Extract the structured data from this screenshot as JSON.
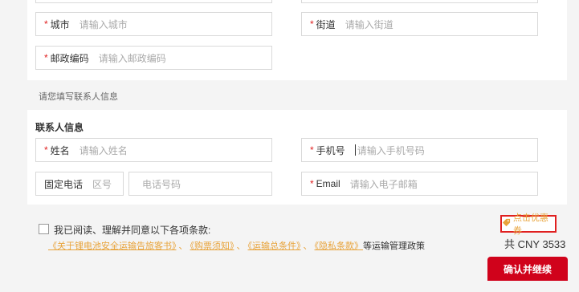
{
  "address": {
    "city": {
      "label": "城市",
      "placeholder": "请输入城市"
    },
    "street": {
      "label": "街道",
      "placeholder": "请输入街道"
    },
    "postcode": {
      "label": "邮政编码",
      "placeholder": "请输入邮政编码"
    }
  },
  "contact_hint": "请您填写联系人信息",
  "contact": {
    "title": "联系人信息",
    "name": {
      "label": "姓名",
      "placeholder": "请输入姓名"
    },
    "mobile": {
      "label": "手机号",
      "placeholder": "请输入手机号码"
    },
    "landline": {
      "label": "固定电话",
      "area_placeholder": "区号",
      "phone_placeholder": "电话号码"
    },
    "email": {
      "label": "Email",
      "placeholder": "请输入电子邮箱"
    }
  },
  "agreement": {
    "text": "我已阅读、理解并同意以下各项条款:",
    "links": [
      "《关于锂电池安全运输告旅客书》",
      "《购票须知》",
      "《运输总条件》",
      "《隐私条款》"
    ],
    "separator": "、",
    "tail": "等运输管理政策"
  },
  "coupon_label": "点击优惠券",
  "total": {
    "prefix": "共",
    "amount": "CNY 3533"
  },
  "confirm_button": "确认并继续",
  "colors": {
    "accent": "#d0021b",
    "link": "#e8a33a",
    "required": "#e02020"
  }
}
